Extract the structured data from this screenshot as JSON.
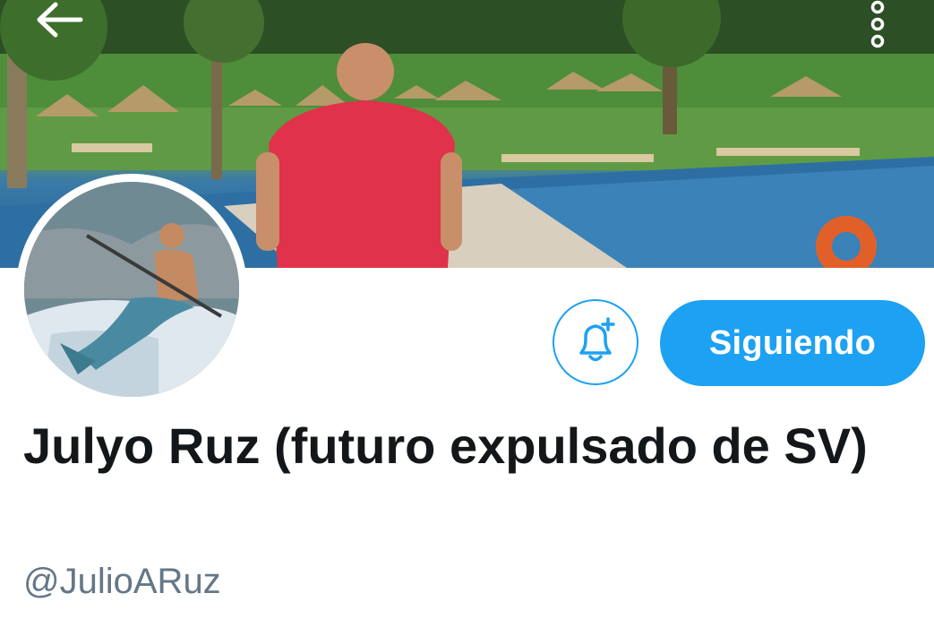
{
  "header": {
    "back_icon": "arrow-left-icon",
    "more_icon": "more-vertical-icon"
  },
  "banner": {
    "description_icon": "banner-photo"
  },
  "profile": {
    "avatar_icon": "avatar-photo",
    "display_name": "Julyo Ruz (futuro expulsado de SV)",
    "handle": "@JulioARuz"
  },
  "actions": {
    "notifications_icon": "bell-plus-icon",
    "follow_label": "Siguiendo"
  },
  "colors": {
    "accent": "#1da1f2",
    "name": "#14171a",
    "handle": "#657786"
  }
}
